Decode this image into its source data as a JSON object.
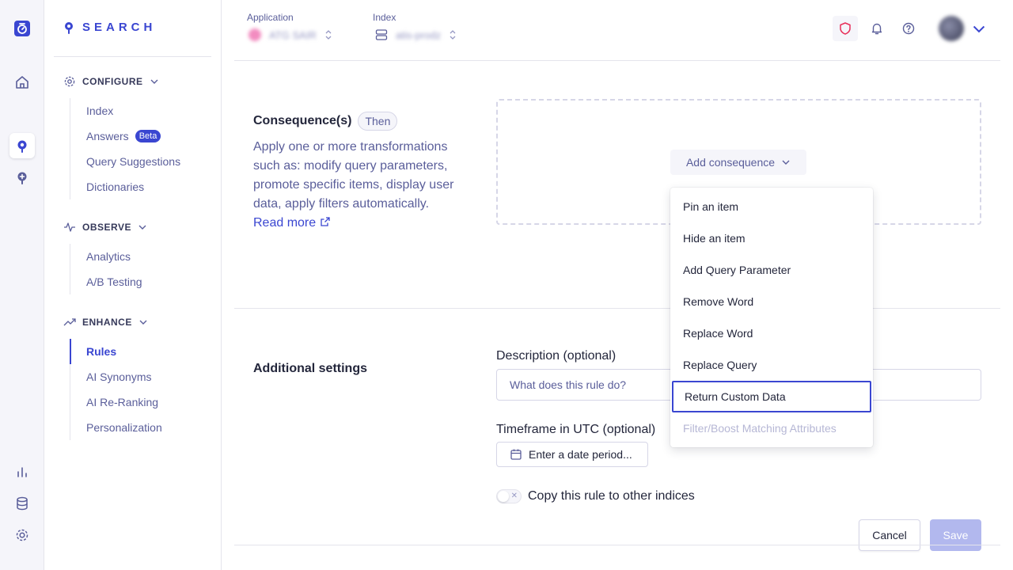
{
  "brand": {
    "name": "SEARCH"
  },
  "sidebar": {
    "sections": [
      {
        "title": "CONFIGURE",
        "icon": "gear-icon",
        "items": [
          {
            "label": "Index"
          },
          {
            "label": "Answers",
            "badge": "Beta"
          },
          {
            "label": "Query Suggestions"
          },
          {
            "label": "Dictionaries"
          }
        ]
      },
      {
        "title": "OBSERVE",
        "icon": "pulse-icon",
        "items": [
          {
            "label": "Analytics"
          },
          {
            "label": "A/B Testing"
          }
        ]
      },
      {
        "title": "ENHANCE",
        "icon": "trend-up-icon",
        "items": [
          {
            "label": "Rules",
            "active": true
          },
          {
            "label": "AI Synonyms"
          },
          {
            "label": "AI Re-Ranking"
          },
          {
            "label": "Personalization"
          }
        ]
      }
    ]
  },
  "header": {
    "application_label": "Application",
    "application_value": "ATG SAIR",
    "index_label": "Index",
    "index_value": "atis-prodz"
  },
  "consequences": {
    "title": "Consequence(s)",
    "tag": "Then",
    "description": "Apply one or more transformations such as: modify query parameters, promote specific items, display user data, apply filters automatically.",
    "read_more": "Read more",
    "add_button": "Add consequence",
    "menu": [
      {
        "label": "Pin an item",
        "state": "normal"
      },
      {
        "label": "Hide an item",
        "state": "normal"
      },
      {
        "label": "Add Query Parameter",
        "state": "normal"
      },
      {
        "label": "Remove Word",
        "state": "normal"
      },
      {
        "label": "Replace Word",
        "state": "normal"
      },
      {
        "label": "Replace Query",
        "state": "normal"
      },
      {
        "label": "Return Custom Data",
        "state": "focused"
      },
      {
        "label": "Filter/Boost Matching Attributes",
        "state": "disabled"
      }
    ]
  },
  "additional": {
    "title": "Additional settings",
    "description_label": "Description (optional)",
    "description_placeholder": "What does this rule do?",
    "timeframe_label": "Timeframe in UTC (optional)",
    "date_button": "Enter a date period...",
    "copy_label": "Copy this rule to other indices",
    "copy_enabled": false
  },
  "footer": {
    "cancel": "Cancel",
    "save": "Save"
  },
  "colors": {
    "accent": "#3a46d1",
    "text": "#23263b",
    "muted": "#5a5e9a",
    "shield": "#e8305a"
  }
}
